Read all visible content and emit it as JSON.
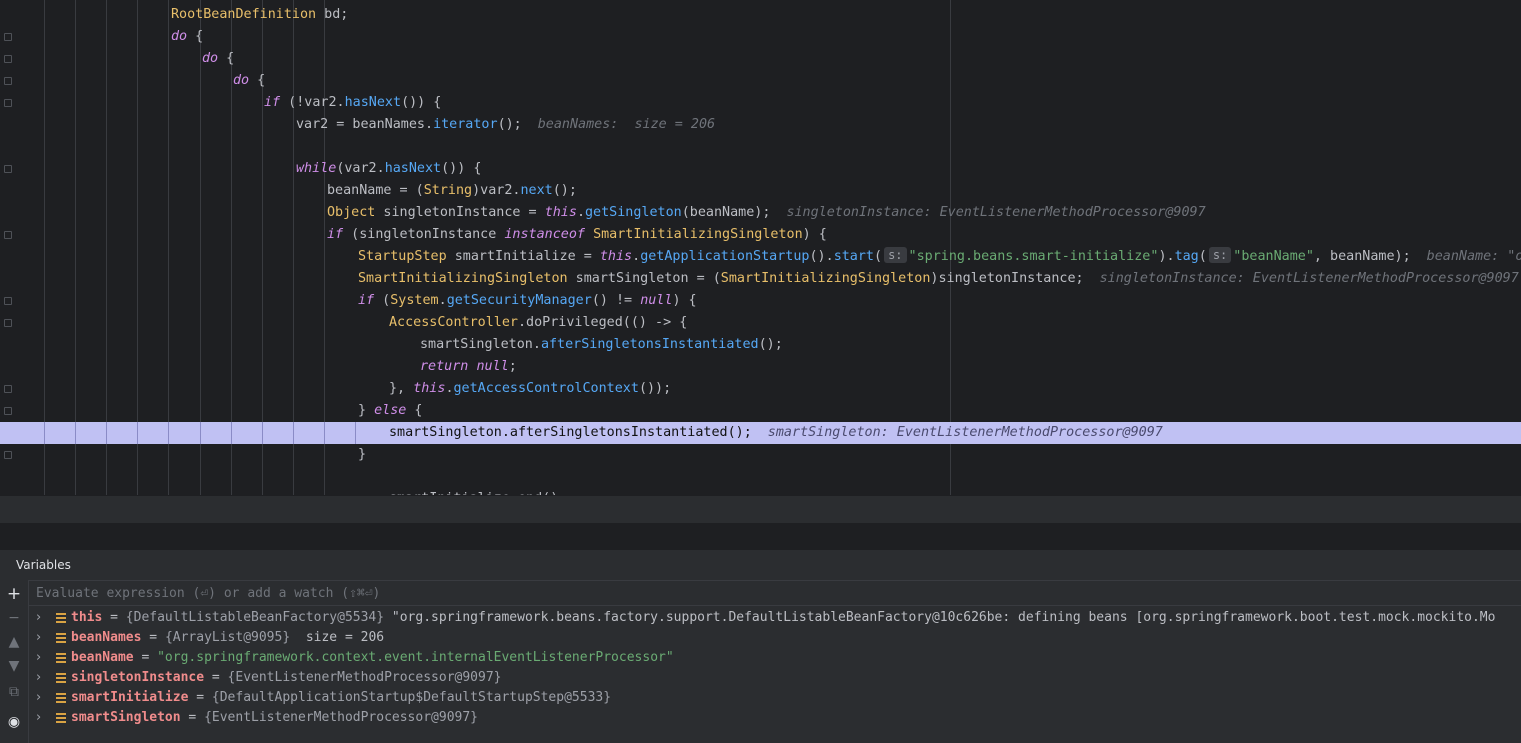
{
  "editor": {
    "lines": [
      {
        "col": 171,
        "parts": [
          {
            "t": "RootBeanDefinition",
            "c": "ty"
          },
          {
            "t": " bd;"
          }
        ]
      },
      {
        "col": 171,
        "parts": [
          {
            "t": "do",
            "c": "kw"
          },
          {
            "t": " {"
          }
        ]
      },
      {
        "col": 202,
        "parts": [
          {
            "t": "do",
            "c": "kw"
          },
          {
            "t": " {"
          }
        ]
      },
      {
        "col": 233,
        "parts": [
          {
            "t": "do",
            "c": "kw"
          },
          {
            "t": " {"
          }
        ]
      },
      {
        "col": 264,
        "parts": [
          {
            "t": "if",
            "c": "kw"
          },
          {
            "t": " (!var2."
          },
          {
            "t": "hasNext",
            "c": "mc"
          },
          {
            "t": "()) {"
          }
        ]
      },
      {
        "col": 296,
        "parts": [
          {
            "t": "var2 = beanNames."
          },
          {
            "t": "iterator",
            "c": "mc"
          },
          {
            "t": "();"
          }
        ],
        "hint": "beanNames:  size = 206"
      },
      {
        "col": 296,
        "parts": []
      },
      {
        "col": 296,
        "parts": [
          {
            "t": "while",
            "c": "kw"
          },
          {
            "t": "(var2."
          },
          {
            "t": "hasNext",
            "c": "mc"
          },
          {
            "t": "()) {"
          }
        ]
      },
      {
        "col": 327,
        "parts": [
          {
            "t": "beanName = ("
          },
          {
            "t": "String",
            "c": "ty"
          },
          {
            "t": ")var2."
          },
          {
            "t": "next",
            "c": "mc"
          },
          {
            "t": "();"
          }
        ]
      },
      {
        "col": 327,
        "parts": [
          {
            "t": "Object",
            "c": "ty"
          },
          {
            "t": " singletonInstance = "
          },
          {
            "t": "this",
            "c": "kw"
          },
          {
            "t": "."
          },
          {
            "t": "getSingleton",
            "c": "mc"
          },
          {
            "t": "(beanName);"
          }
        ],
        "hint": "singletonInstance: EventListenerMethodProcessor@9097"
      },
      {
        "col": 327,
        "parts": [
          {
            "t": "if",
            "c": "kw"
          },
          {
            "t": " (singletonInstance "
          },
          {
            "t": "instanceof",
            "c": "kw"
          },
          {
            "t": " "
          },
          {
            "t": "SmartInitializingSingleton",
            "c": "ty"
          },
          {
            "t": ") {"
          }
        ]
      },
      {
        "col": 358,
        "parts": [
          {
            "t": "StartupStep",
            "c": "ty"
          },
          {
            "t": " smartInitialize = "
          },
          {
            "t": "this",
            "c": "kw"
          },
          {
            "t": "."
          },
          {
            "t": "getApplicationStartup",
            "c": "mc"
          },
          {
            "t": "()."
          },
          {
            "t": "start",
            "c": "mc"
          },
          {
            "t": "("
          },
          {
            "t": "s:",
            "c": "pill"
          },
          {
            "t": "\"spring.beans.smart-initialize\"",
            "c": "st"
          },
          {
            "t": ")."
          },
          {
            "t": "tag",
            "c": "mc"
          },
          {
            "t": "("
          },
          {
            "t": "s:",
            "c": "pill"
          },
          {
            "t": "\"beanName\"",
            "c": "st"
          },
          {
            "t": ", beanName);"
          }
        ],
        "hint": "beanName: \"org.s"
      },
      {
        "col": 358,
        "parts": [
          {
            "t": "SmartInitializingSingleton",
            "c": "ty"
          },
          {
            "t": " smartSingleton = ("
          },
          {
            "t": "SmartInitializingSingleton",
            "c": "ty"
          },
          {
            "t": ")singletonInstance;"
          }
        ],
        "hint": "singletonInstance: EventListenerMethodProcessor@9097    s"
      },
      {
        "col": 358,
        "parts": [
          {
            "t": "if",
            "c": "kw"
          },
          {
            "t": " ("
          },
          {
            "t": "System",
            "c": "ty"
          },
          {
            "t": "."
          },
          {
            "t": "getSecurityManager",
            "c": "mc"
          },
          {
            "t": "() != "
          },
          {
            "t": "null",
            "c": "kw"
          },
          {
            "t": ") {"
          }
        ]
      },
      {
        "col": 389,
        "parts": [
          {
            "t": "AccessController",
            "c": "ty"
          },
          {
            "t": ".doPrivileged(() -> {"
          }
        ]
      },
      {
        "col": 420,
        "parts": [
          {
            "t": "smartSingleton."
          },
          {
            "t": "afterSingletonsInstantiated",
            "c": "mc"
          },
          {
            "t": "();"
          }
        ]
      },
      {
        "col": 420,
        "parts": [
          {
            "t": "return",
            "c": "kw"
          },
          {
            "t": " "
          },
          {
            "t": "null",
            "c": "kw"
          },
          {
            "t": ";"
          }
        ]
      },
      {
        "col": 389,
        "parts": [
          {
            "t": "}, "
          },
          {
            "t": "this",
            "c": "kw"
          },
          {
            "t": "."
          },
          {
            "t": "getAccessControlContext",
            "c": "mc"
          },
          {
            "t": "());"
          }
        ]
      },
      {
        "col": 358,
        "parts": [
          {
            "t": "} "
          },
          {
            "t": "else",
            "c": "kw"
          },
          {
            "t": " {"
          }
        ]
      },
      {
        "col": 389,
        "parts": [
          {
            "t": "smartSingleton.afterSingletonsInstantiated();"
          }
        ],
        "hint": "smartSingleton: EventListenerMethodProcessor@9097",
        "exec": true
      },
      {
        "col": 358,
        "parts": [
          {
            "t": "}"
          }
        ]
      },
      {
        "col": 358,
        "parts": []
      },
      {
        "col": 389,
        "parts": [
          {
            "t": "smartInitialize.end();"
          }
        ]
      }
    ]
  },
  "variables": {
    "title": "Variables",
    "eval_placeholder": "Evaluate expression (⏎) or add a watch (⇧⌘⏎)",
    "toolbar_icons": [
      "plus-icon",
      "minus-icon",
      "arrow-up-icon",
      "arrow-down-icon",
      "copy-icon",
      "watch-icon"
    ],
    "items": [
      {
        "name": "this",
        "equals": " = ",
        "ref": "{DefaultListableBeanFactory@5534}",
        "value": " \"org.springframework.beans.factory.support.DefaultListableBeanFactory@10c626be: defining beans [org.springframework.boot.test.mock.mockito.Mo"
      },
      {
        "name": "beanNames",
        "equals": " = ",
        "ref": "{ArrayList@9095}",
        "value": "  size = 206"
      },
      {
        "name": "beanName",
        "equals": " = ",
        "ref": "",
        "value": "\"org.springframework.context.event.internalEventListenerProcessor\""
      },
      {
        "name": "singletonInstance",
        "equals": " = ",
        "ref": "{EventListenerMethodProcessor@9097}",
        "value": ""
      },
      {
        "name": "smartInitialize",
        "equals": " = ",
        "ref": "{DefaultApplicationStartup$DefaultStartupStep@5533}",
        "value": ""
      },
      {
        "name": "smartSingleton",
        "equals": " = ",
        "ref": "{EventListenerMethodProcessor@9097}",
        "value": ""
      }
    ]
  }
}
